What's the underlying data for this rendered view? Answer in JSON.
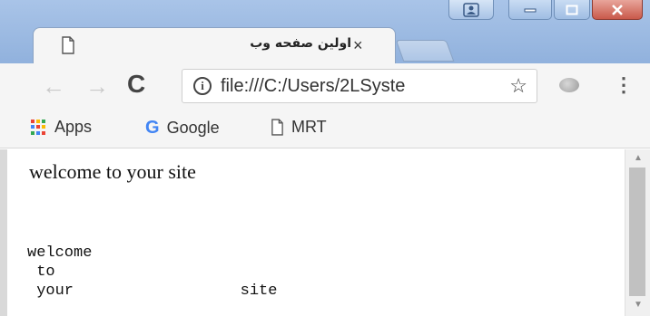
{
  "window": {
    "controls": [
      "profile",
      "minimize",
      "maximize",
      "close"
    ]
  },
  "tab": {
    "title": "اولین صفحه وب",
    "close_label": "×",
    "icon": "page-icon"
  },
  "toolbar": {
    "back_icon": "←",
    "forward_icon": "→",
    "reload_icon": "C",
    "info_icon": "i",
    "url": "file:///C:/Users/2LSyste",
    "star_icon": "☆",
    "menu_icon": "⋮"
  },
  "bookmarks": {
    "items": [
      {
        "label": "Apps",
        "icon": "apps-icon"
      },
      {
        "label": "Google",
        "icon": "google-icon",
        "glyph": "G"
      },
      {
        "label": "MRT",
        "icon": "page-icon"
      }
    ]
  },
  "page": {
    "heading_text": "welcome to your site",
    "pre_text": "welcome\n to\n your                  site"
  },
  "colors": {
    "titlebar": "#a9c4e8",
    "google_blue": "#4285f4",
    "apps_grid": [
      "#ea4335",
      "#fbbc05",
      "#34a853",
      "#4285f4",
      "#ea4335",
      "#fbbc05",
      "#34a853",
      "#4285f4",
      "#ea4335"
    ]
  }
}
